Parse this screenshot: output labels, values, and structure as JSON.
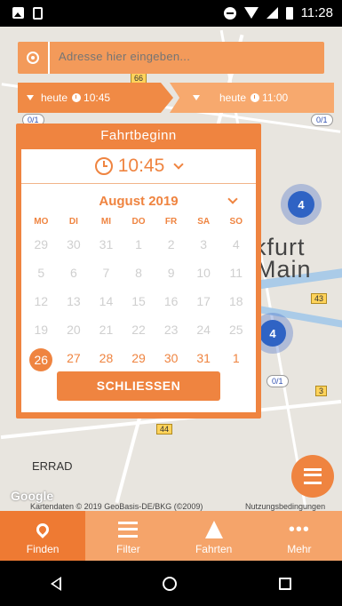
{
  "status_bar": {
    "time": "11:28"
  },
  "search": {
    "placeholder": "Adresse hier eingeben..."
  },
  "time_chips": [
    {
      "label": "heute",
      "time": "10:45"
    },
    {
      "label": "heute",
      "time": "11:00"
    }
  ],
  "map": {
    "city_line1": "nkfurt",
    "city_line2": "Main",
    "label_eerrad": "ERRAD",
    "clusters": [
      "4",
      "4"
    ],
    "shields": [
      "66",
      "43",
      "44",
      "3"
    ],
    "pins": [
      "0/1",
      "0/1",
      "0/1"
    ],
    "google": "Google",
    "credits": "Kartendaten © 2019 GeoBasis-DE/BKG (©2009)",
    "terms": "Nutzungsbedingungen"
  },
  "picker": {
    "title": "Fahrtbeginn",
    "time": "10:45",
    "month": "August 2019",
    "weekdays": [
      "MO",
      "DI",
      "MI",
      "DO",
      "FR",
      "SA",
      "SO"
    ],
    "weeks": [
      [
        "29",
        "30",
        "31",
        "1",
        "2",
        "3",
        "4"
      ],
      [
        "5",
        "6",
        "7",
        "8",
        "9",
        "10",
        "11"
      ],
      [
        "12",
        "13",
        "14",
        "15",
        "16",
        "17",
        "18"
      ],
      [
        "19",
        "20",
        "21",
        "22",
        "23",
        "24",
        "25"
      ],
      [
        "26",
        "27",
        "28",
        "29",
        "30",
        "31",
        "1"
      ]
    ],
    "selected_day": "26",
    "close_label": "SCHLIESSEN"
  },
  "bottom_nav": [
    {
      "label": "Finden",
      "icon": "map-pin-icon"
    },
    {
      "label": "Filter",
      "icon": "filter-icon"
    },
    {
      "label": "Fahrten",
      "icon": "road-icon"
    },
    {
      "label": "Mehr",
      "icon": "more-icon"
    }
  ],
  "colors": {
    "accent": "#ef8440",
    "accent_dark": "#ee7a33",
    "nav_bg": "#f5a46a"
  }
}
